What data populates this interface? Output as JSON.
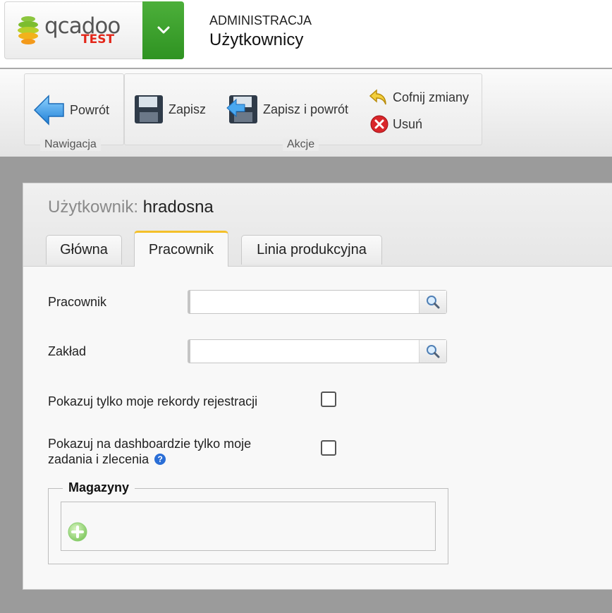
{
  "header": {
    "logo_text": "qcadoo",
    "logo_badge": "TEST",
    "section": "ADMINISTRACJA",
    "page": "Użytkownicy"
  },
  "ribbon": {
    "navigation": {
      "label": "Nawigacja",
      "back_label": "Powrót"
    },
    "actions": {
      "label": "Akcje",
      "save_label": "Zapisz",
      "save_back_label": "Zapisz i powrót",
      "undo_label": "Cofnij zmiany",
      "delete_label": "Usuń"
    }
  },
  "form": {
    "title_label": "Użytkownik:",
    "title_value": "hradosna",
    "tabs": [
      {
        "label": "Główna"
      },
      {
        "label": "Pracownik",
        "active": true
      },
      {
        "label": "Linia produkcyjna"
      }
    ],
    "fields": {
      "employee": {
        "label": "Pracownik",
        "value": ""
      },
      "factory": {
        "label": "Zakład",
        "value": ""
      },
      "only_my_records": {
        "label": "Pokazuj tylko moje rekordy rejestracji",
        "checked": false
      },
      "dashboard_only_mine": {
        "label_line1": "Pokazuj na dashboardzie tylko moje",
        "label_line2": "zadania i zlecenia",
        "checked": false,
        "help": "?"
      }
    },
    "warehouses": {
      "legend": "Magazyny"
    }
  }
}
